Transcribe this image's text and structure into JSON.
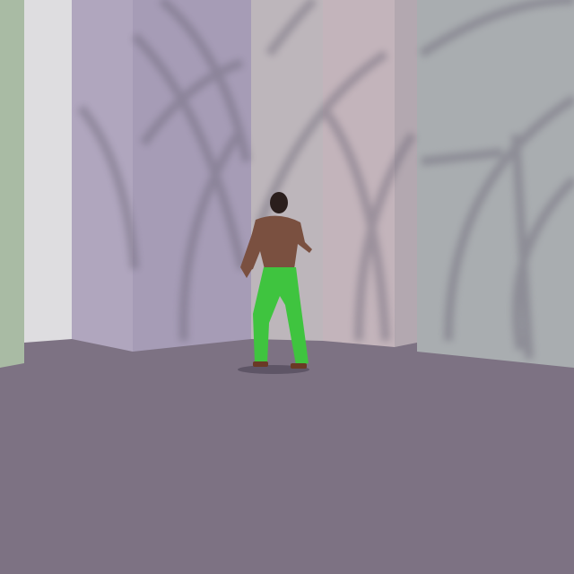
{
  "scene": {
    "colors": {
      "floor": "#7d7283",
      "wall_green": "#a9bba4",
      "pillar_white": "#dedde0",
      "wall_lavender": "#b0a6be",
      "wall_purple": "#a69cb6",
      "wall_pink": "#c3b4bb",
      "wall_gray": "#a9adb0",
      "pattern": "#6d6878",
      "character_skin": "#7a5040",
      "character_pants": "#3fc43f"
    }
  }
}
